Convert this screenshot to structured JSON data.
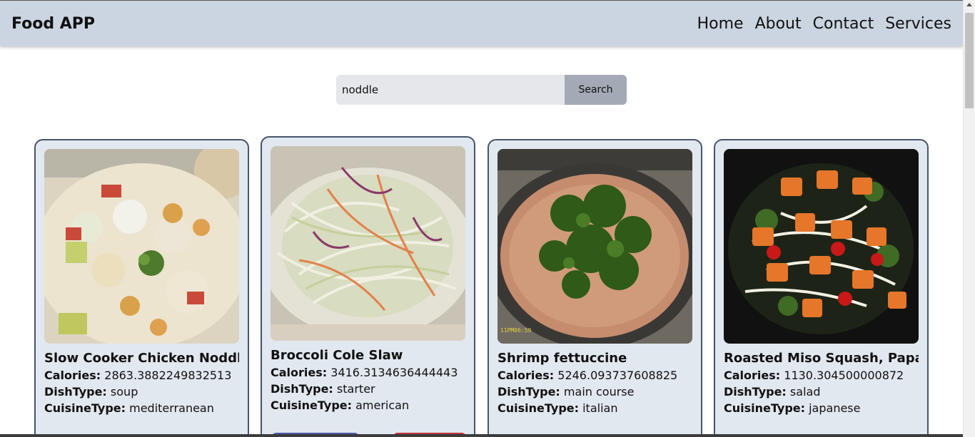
{
  "navbar": {
    "brand": "Food APP",
    "links": [
      "Home",
      "About",
      "Contact",
      "Services"
    ]
  },
  "search": {
    "value": "noddle",
    "button_label": "Search"
  },
  "labels": {
    "calories": "Calories:",
    "dish_type": "DishType:",
    "cuisine_type": "CuisineType:"
  },
  "cards": [
    {
      "title": "Slow Cooker Chicken Noddl",
      "calories": "2863.3882249832513",
      "dish_type": "soup",
      "cuisine_type": "mediterranean",
      "image": "chicken-noodle-soup-photo"
    },
    {
      "title": "Broccoli Cole Slaw",
      "calories": "3416.3134636444443",
      "dish_type": "starter",
      "cuisine_type": "american",
      "image": "broccoli-coleslaw-photo"
    },
    {
      "title": "Shrimp fettuccine",
      "calories": "5246.093737608825",
      "dish_type": "main course",
      "cuisine_type": "italian",
      "image": "shrimp-fettuccine-pan-photo"
    },
    {
      "title": "Roasted Miso Squash, Papa",
      "calories": "1130.304500000872",
      "dish_type": "salad",
      "cuisine_type": "japanese",
      "image": "miso-squash-noodle-photo"
    }
  ],
  "colors": {
    "navbar_bg": "#cbd5e1",
    "card_bg": "#e2e8f0",
    "card_border": "#475569",
    "button_blue": "#4c5aa8",
    "button_red": "#c2323a"
  }
}
